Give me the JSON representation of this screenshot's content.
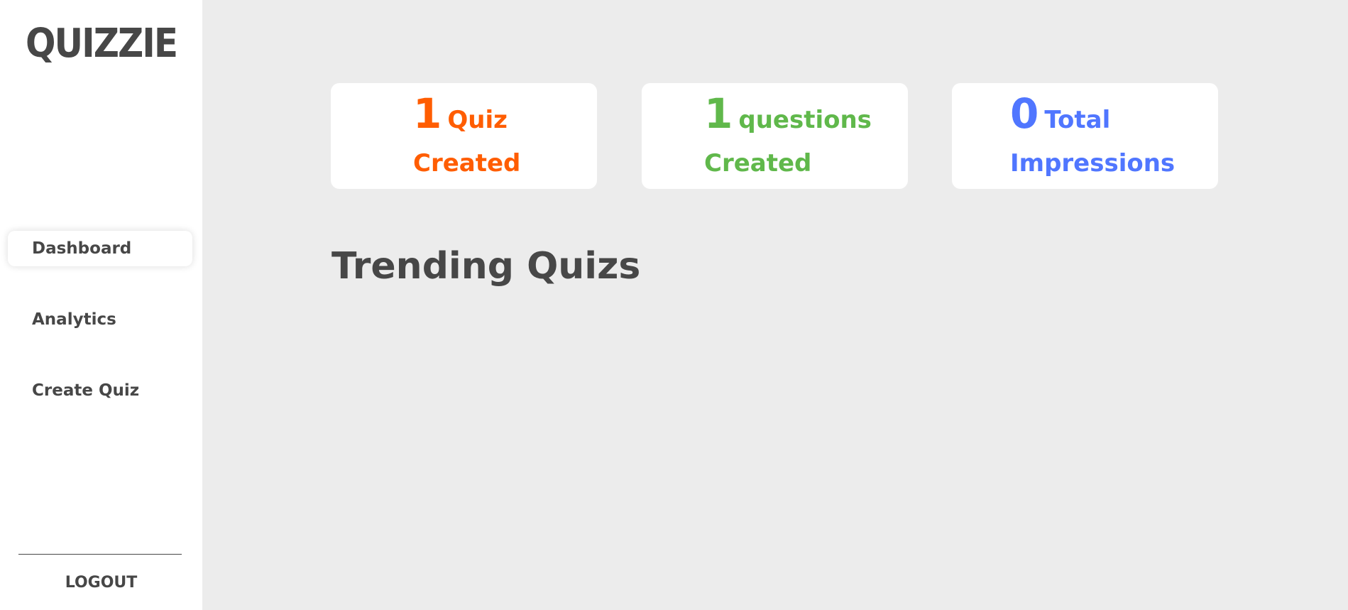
{
  "app": {
    "logo": "QUIZZIE"
  },
  "sidebar": {
    "items": [
      {
        "label": "Dashboard",
        "active": true
      },
      {
        "label": "Analytics",
        "active": false
      },
      {
        "label": "Create Quiz",
        "active": false
      }
    ],
    "logout_label": "LOGOUT"
  },
  "stats": [
    {
      "value": "1",
      "word": "Quiz",
      "label": "Created",
      "color": "#ff5d01"
    },
    {
      "value": "1",
      "word": "questions",
      "label": "Created",
      "color": "#60b84b"
    },
    {
      "value": "0",
      "word": "Total",
      "label": "Impressions",
      "color": "#5076ff"
    }
  ],
  "main": {
    "trending_title": "Trending Quizs"
  },
  "colors": {
    "sidebar_bg": "#ffffff",
    "main_bg": "#ececec",
    "text_dark": "#474747"
  }
}
